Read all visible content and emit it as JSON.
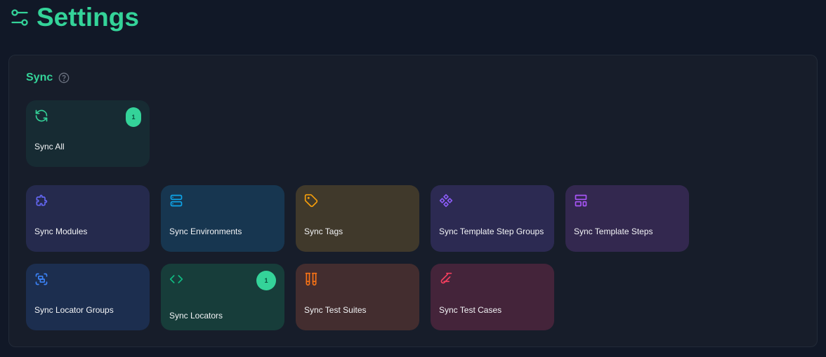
{
  "header": {
    "title": "Settings",
    "icon": "sliders-icon"
  },
  "section": {
    "title": "Sync",
    "help_icon": "help-circle-icon"
  },
  "cards": [
    {
      "label": "Sync All",
      "icon": "refresh-icon",
      "color": "#34d399",
      "bg": "#172b33",
      "badge": "1"
    },
    {
      "label": "Sync Modules",
      "icon": "puzzle-icon",
      "color": "#6366f1",
      "bg": "#252a4d"
    },
    {
      "label": "Sync Environments",
      "icon": "server-icon",
      "color": "#0ea5e9",
      "bg": "#173650"
    },
    {
      "label": "Sync Tags",
      "icon": "tag-icon",
      "color": "#f59e0b",
      "bg": "#40392b"
    },
    {
      "label": "Sync Template Step Groups",
      "icon": "component-icon",
      "color": "#8b5cf6",
      "bg": "#2c2a52"
    },
    {
      "label": "Sync Template Steps",
      "icon": "layout-template-icon",
      "color": "#a855f7",
      "bg": "#33284f"
    },
    {
      "label": "Sync Locator Groups",
      "icon": "group-icon",
      "color": "#3b82f6",
      "bg": "#1c2e4f"
    },
    {
      "label": "Sync Locators",
      "icon": "code-icon",
      "color": "#10b981",
      "bg": "#173d3a",
      "badge": "1"
    },
    {
      "label": "Sync Test Suites",
      "icon": "test-tubes-icon",
      "color": "#f97316",
      "bg": "#432d2f"
    },
    {
      "label": "Sync Test Cases",
      "icon": "test-tube-icon",
      "color": "#f43f5e",
      "bg": "#44243a"
    }
  ]
}
